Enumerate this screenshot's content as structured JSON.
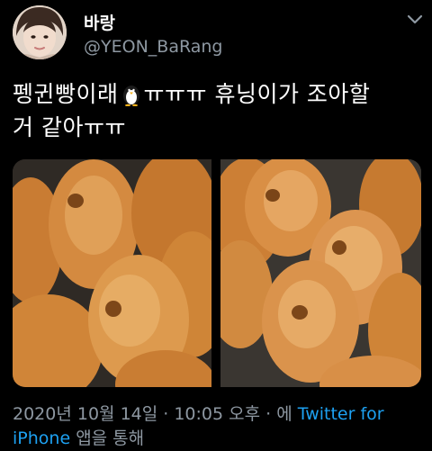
{
  "user": {
    "display_name": "바랑",
    "handle": "@YEON_BaRang",
    "avatar_icon": "profile-photo",
    "menu_icon": "chevron-down-icon"
  },
  "tweet": {
    "text_line1_before": "펭귄빵이래",
    "emoji": "penguin-emoji",
    "text_line1_after": "ㅠㅠㅠ 휴닝이가 조아할",
    "text_line2": "거 같아ㅠㅠ"
  },
  "media": {
    "photos": [
      {
        "subject": "penguin-shaped pastry photo"
      },
      {
        "subject": "penguin-shaped pastry photo"
      }
    ]
  },
  "meta": {
    "timestamp": "2020년 10월 14일 · 10:05 오후 · 에",
    "source_part1": "Twitter for",
    "source_part2": "iPhone",
    "suffix": "앱을 통해"
  },
  "colors": {
    "background": "#000000",
    "text_primary": "#ffffff",
    "text_secondary": "#8e98a2",
    "link": "#1da1f2",
    "pastry": "#d58a3c"
  }
}
